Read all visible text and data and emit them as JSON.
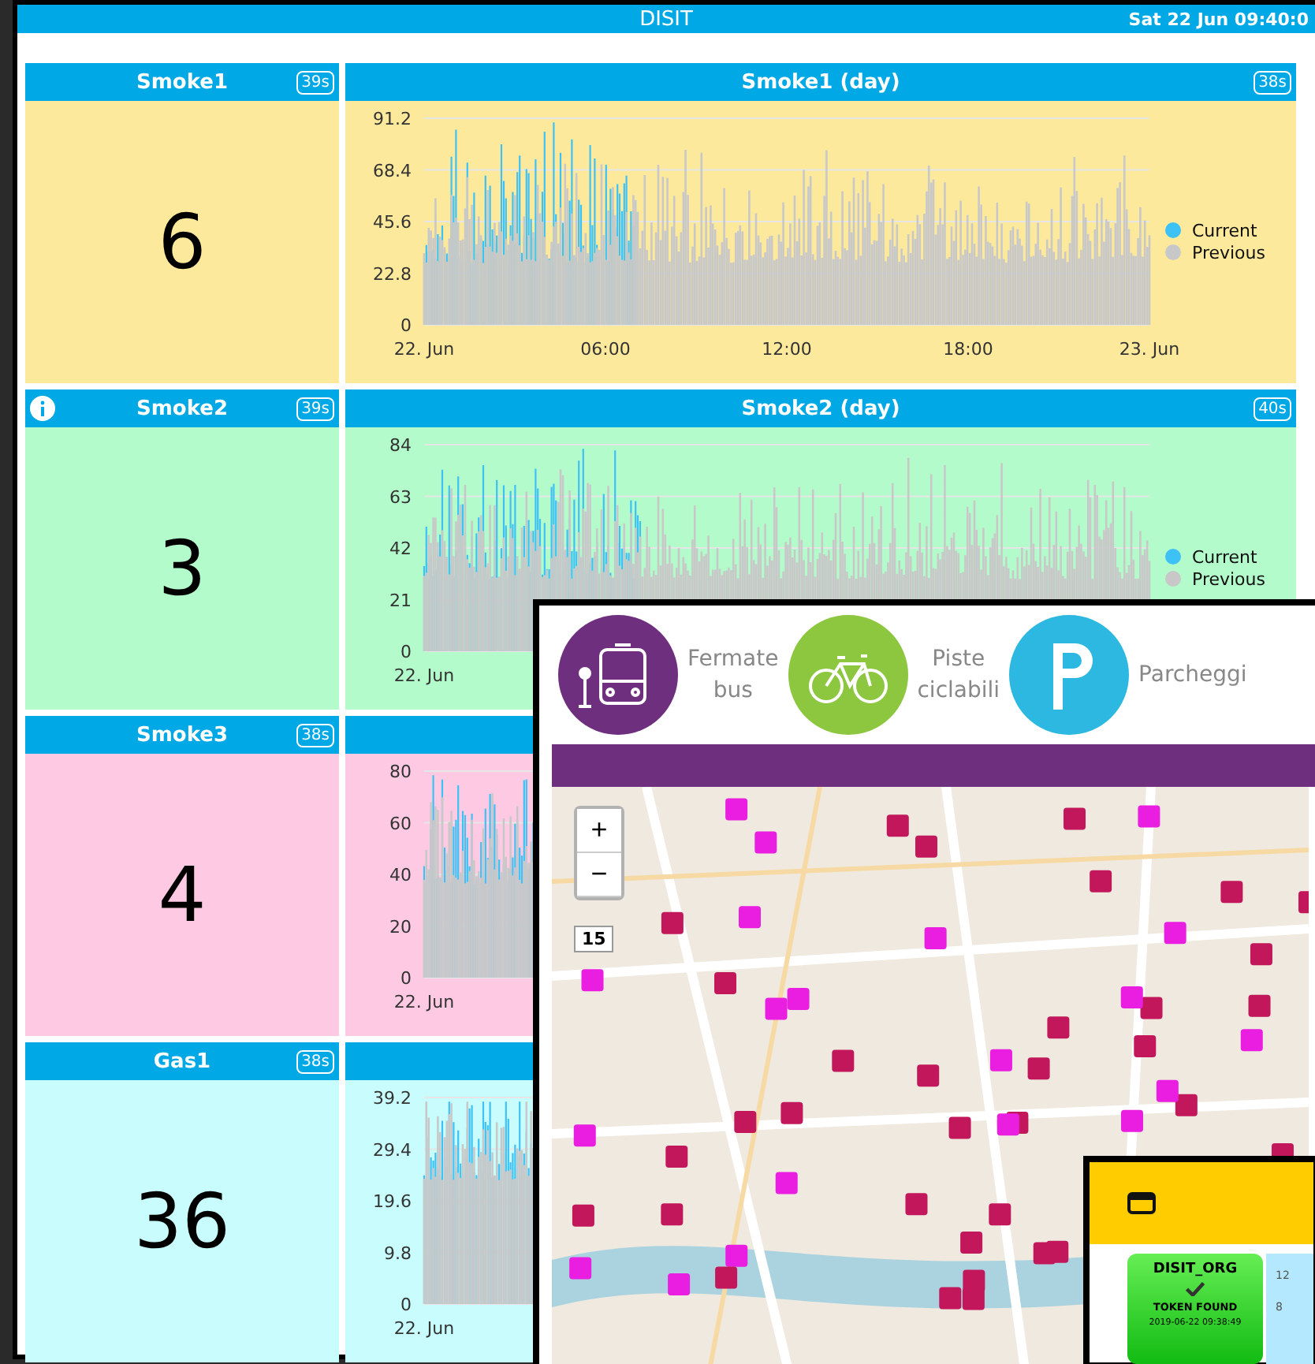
{
  "header": {
    "title": "DISIT",
    "datetime": "Sat 22 Jun 09:40:0"
  },
  "rows": [
    {
      "color": "#fde99c",
      "value_widget": {
        "title": "Smoke1",
        "timer": "39s",
        "info_icon": false,
        "value": "6"
      },
      "chart_widget": {
        "title": "Smoke1 (day)",
        "timer": "38s",
        "y_labels": [
          "91.2",
          "68.4",
          "45.6",
          "22.8",
          "0"
        ],
        "x_labels": [
          "22. Jun",
          "06:00",
          "12:00",
          "18:00",
          "23. Jun"
        ],
        "legend": [
          {
            "name": "Current",
            "color": "#3ec1f5"
          },
          {
            "name": "Previous",
            "color": "#c8c8c8"
          }
        ]
      }
    },
    {
      "color": "#b3fbcb",
      "value_widget": {
        "title": "Smoke2",
        "timer": "39s",
        "info_icon": true,
        "value": "3"
      },
      "chart_widget": {
        "title": "Smoke2 (day)",
        "timer": "40s",
        "y_labels": [
          "84",
          "63",
          "42",
          "21",
          "0"
        ],
        "x_labels": [
          "22. Jun"
        ],
        "legend": [
          {
            "name": "Current",
            "color": "#3ec1f5"
          },
          {
            "name": "Previous",
            "color": "#c8c8c8"
          }
        ]
      }
    },
    {
      "color": "#fecae3",
      "value_widget": {
        "title": "Smoke3",
        "timer": "38s",
        "info_icon": false,
        "value": "4"
      },
      "chart_widget": {
        "y_labels": [
          "80",
          "60",
          "40",
          "20",
          "0"
        ],
        "x_labels": [
          "22. Jun"
        ]
      }
    },
    {
      "color": "#c9fdfd",
      "value_widget": {
        "title": "Gas1",
        "timer": "38s",
        "info_icon": false,
        "value": "36"
      },
      "chart_widget": {
        "y_labels": [
          "39.2",
          "29.4",
          "19.6",
          "9.8",
          "0"
        ],
        "x_labels": [
          "22. Jun"
        ]
      }
    }
  ],
  "map_window": {
    "categories": [
      {
        "label": "Fermate bus",
        "kind": "bus",
        "color": "#6f2f7f"
      },
      {
        "label": "Piste ciclabili",
        "kind": "bike",
        "color": "#8dc63f"
      },
      {
        "label": "Parcheggi",
        "kind": "parking",
        "color": "#2cb8e0"
      }
    ],
    "zoom_in": "+",
    "zoom_out": "−",
    "zoom_level": "15"
  },
  "token_window": {
    "card": {
      "title": "DISIT_ORG",
      "status": "TOKEN FOUND",
      "timestamp": "2019-06-22 09:38:49"
    },
    "side_labels": [
      "12",
      "8"
    ]
  }
}
